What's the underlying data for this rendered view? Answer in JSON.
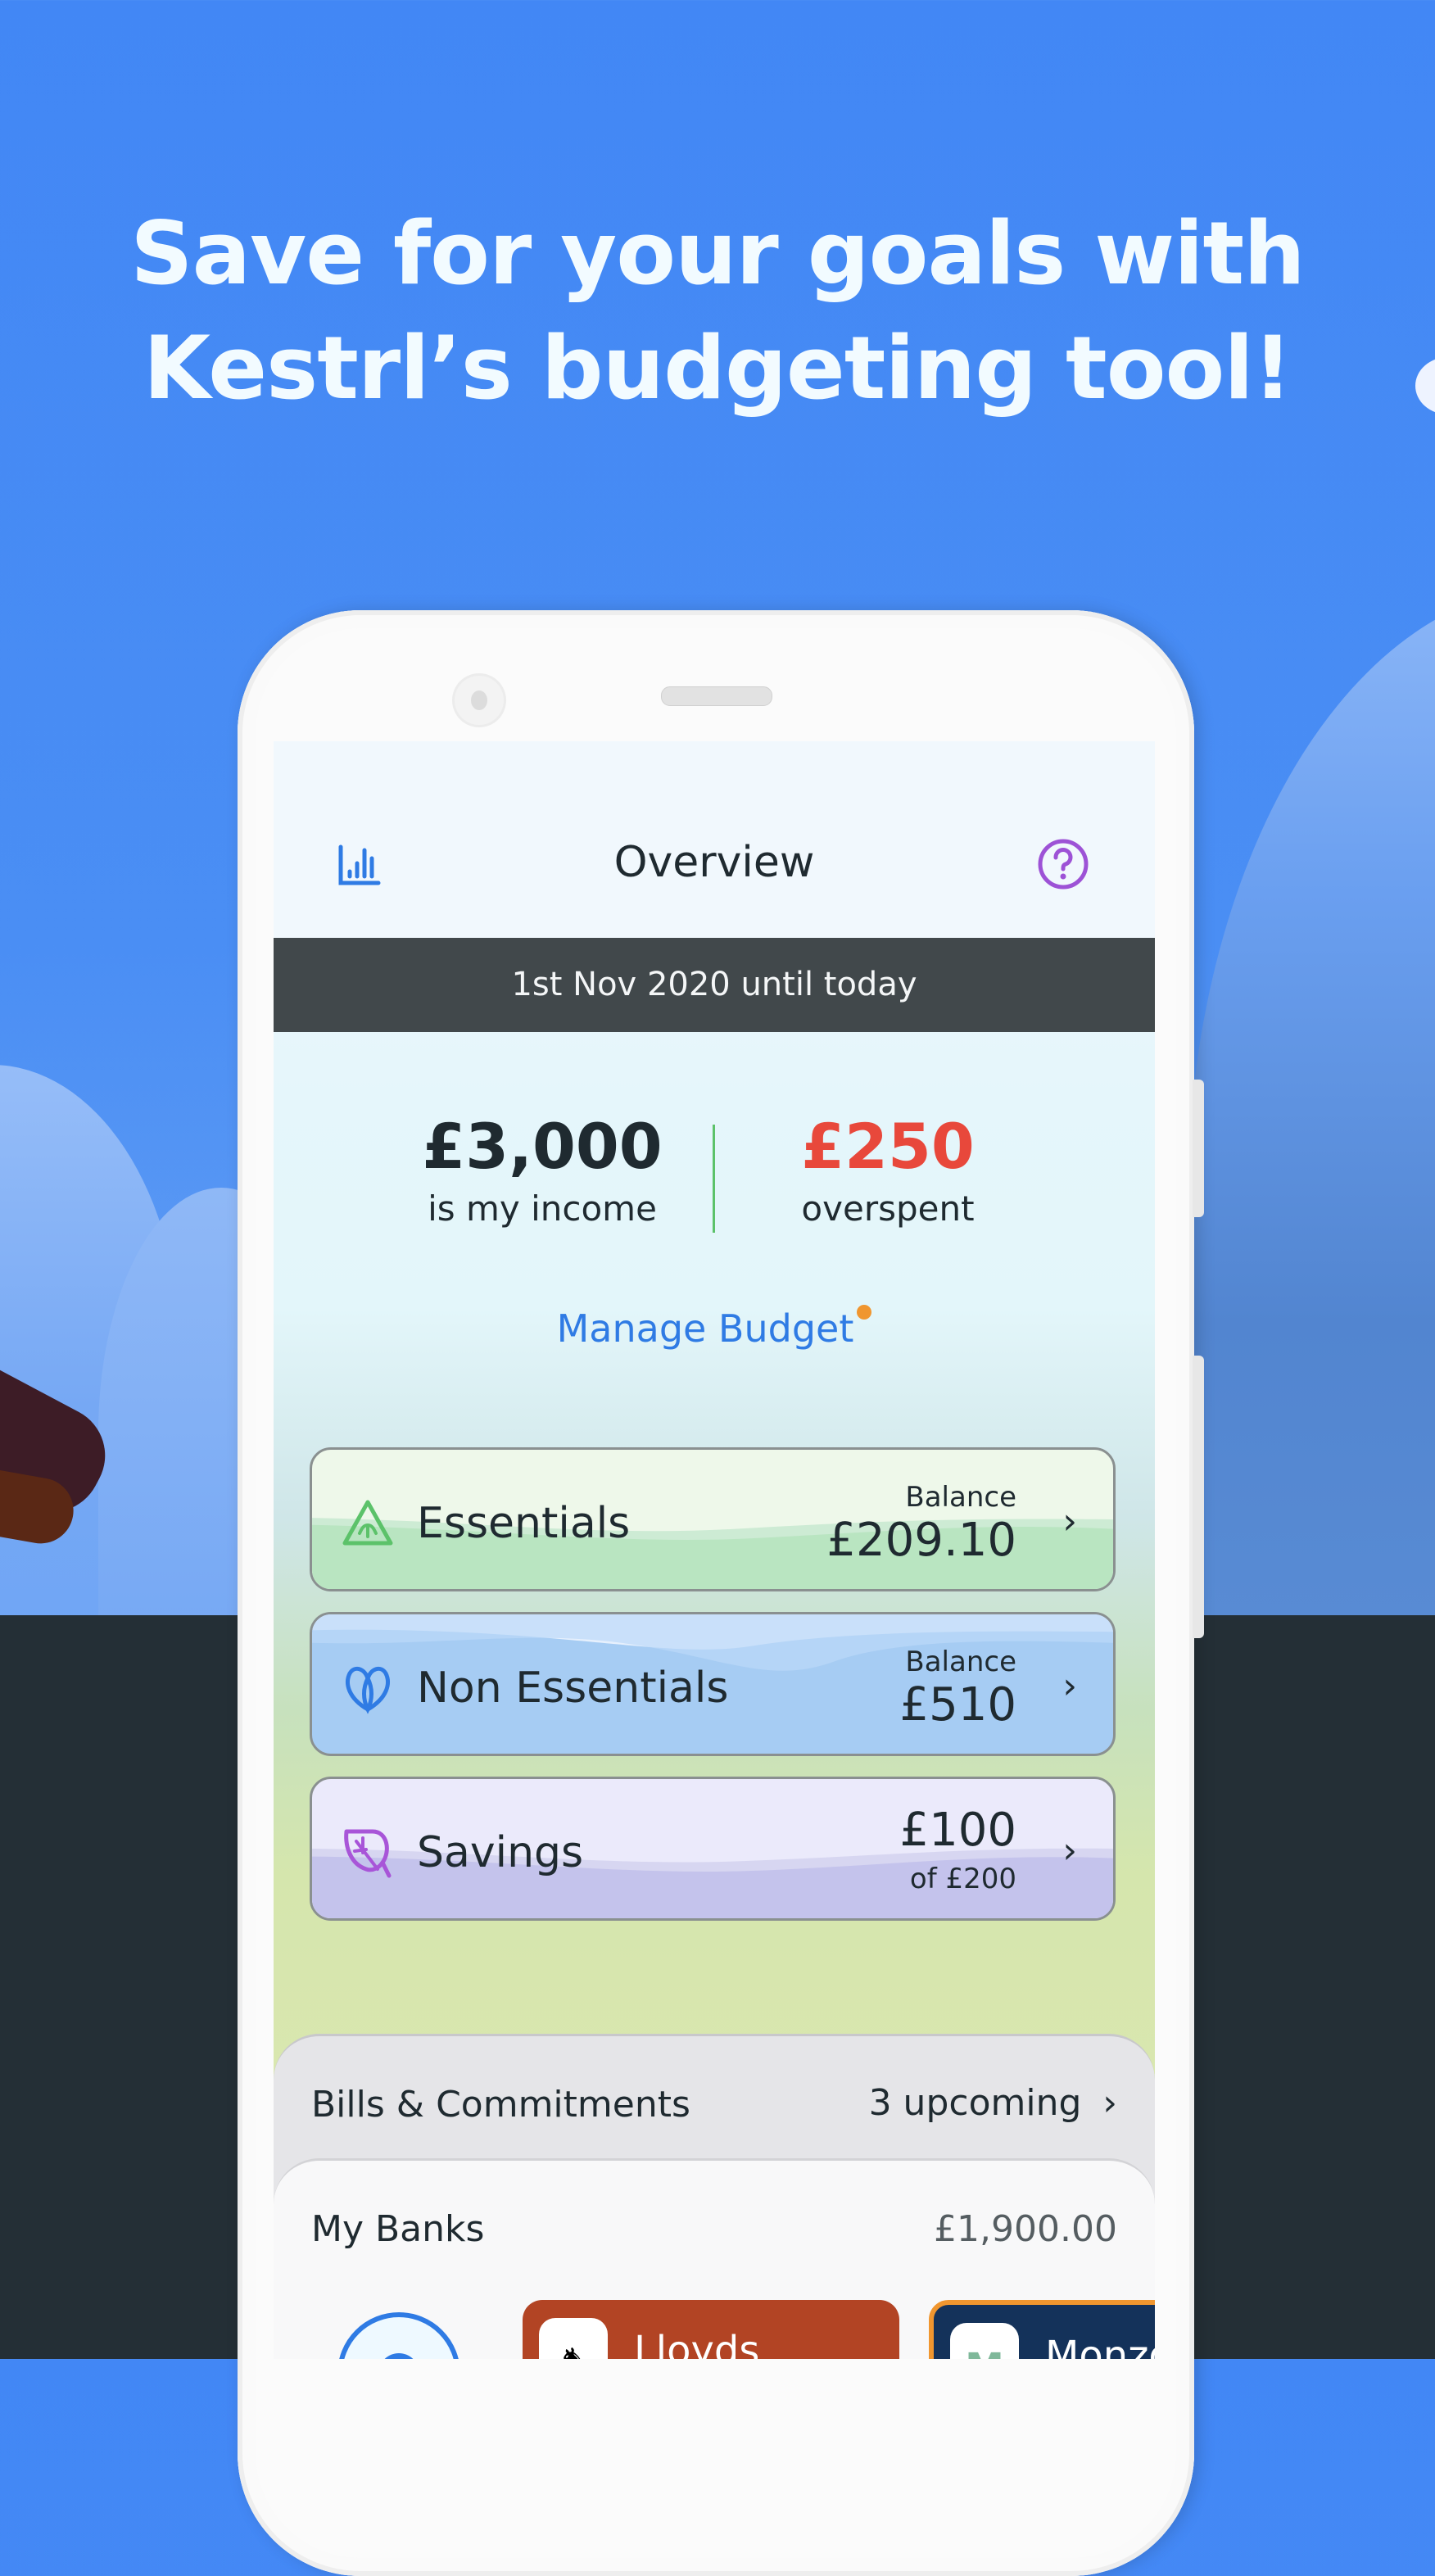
{
  "headline": {
    "line1": "Save for your goals with",
    "line2": "Kestrl’s budgeting tool!"
  },
  "app": {
    "title": "Overview",
    "left_icon": "bar-chart-icon",
    "right_icon": "help-circle-icon",
    "period": "1st Nov 2020 until today",
    "income": {
      "amount": "£3,000",
      "label": "is my income"
    },
    "overspent": {
      "amount": "£250",
      "label": "overspent",
      "color": "#e8483b"
    },
    "manage_budget": {
      "label": "Manage Budget",
      "has_notification_dot": true
    },
    "categories": [
      {
        "name": "Essentials",
        "icon": "triangle-sprout-icon",
        "caption": "Balance",
        "value": "£209.10"
      },
      {
        "name": "Non Essentials",
        "icon": "heart-loops-icon",
        "caption": "Balance",
        "value": "£510"
      },
      {
        "name": "Savings",
        "icon": "leaf-icon",
        "value": "£100",
        "caption": "of £200"
      }
    ],
    "bills": {
      "label": "Bills & Commitments",
      "status": "3 upcoming"
    },
    "banks": {
      "label": "My Banks",
      "total": "£1,900.00",
      "items": [
        {
          "name": "Lloyds",
          "color": "#b24424"
        },
        {
          "name": "Monzo",
          "color": "#14325a",
          "border": "#f0962f"
        }
      ]
    }
  },
  "colors": {
    "accent_blue": "#2f7be4",
    "sky": "#4287f5",
    "purple": "#9d52d6",
    "green": "#5cc26a"
  }
}
